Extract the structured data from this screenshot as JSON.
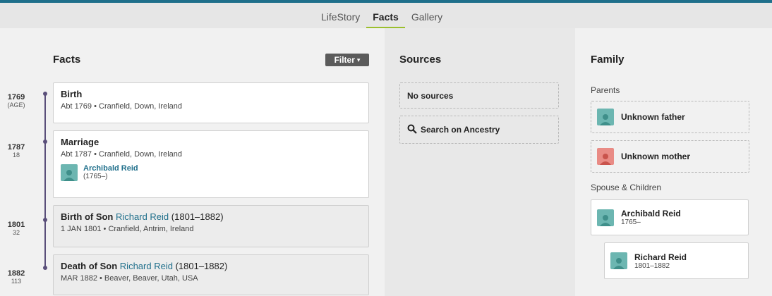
{
  "nav": {
    "tabs": [
      {
        "label": "LifeStory"
      },
      {
        "label": "Facts"
      },
      {
        "label": "Gallery"
      }
    ]
  },
  "facts_section": {
    "title": "Facts",
    "filter_label": "Filter",
    "events": [
      {
        "year": "1769",
        "age": "(AGE)",
        "title": "Birth",
        "detail": "Abt 1769 • Cranfield, Down, Ireland"
      },
      {
        "year": "1787",
        "age": "18",
        "title": "Marriage",
        "detail": "Abt 1787 • Cranfield, Down, Ireland",
        "spouse": {
          "name": "Archibald Reid",
          "life": "(1765–)"
        }
      },
      {
        "year": "1801",
        "age": "32",
        "title_prefix": "Birth of Son",
        "person": "Richard Reid",
        "life": "(1801–1882)",
        "detail": "1 JAN 1801 • Cranfield, Antrim, Ireland"
      },
      {
        "year": "1882",
        "age": "113",
        "title_prefix": "Death of Son",
        "person": "Richard Reid",
        "life": "(1801–1882)",
        "detail": "MAR 1882 • Beaver, Beaver, Utah, USA"
      }
    ]
  },
  "sources_section": {
    "title": "Sources",
    "no_sources": "No sources",
    "search_label": "Search on Ancestry"
  },
  "family_section": {
    "title": "Family",
    "parents_label": "Parents",
    "father": "Unknown father",
    "mother": "Unknown mother",
    "spouse_label": "Spouse & Children",
    "spouse": {
      "name": "Archibald Reid",
      "life": "1765–"
    },
    "child": {
      "name": "Richard Reid",
      "life": "1801–1882"
    }
  },
  "colors": {
    "accent": "#1f6f8b",
    "active_tab_underline": "#9bbf2d",
    "timeline": "#5a4f7a",
    "male_avatar": "#6cb6b1",
    "female_avatar": "#e98b85"
  }
}
